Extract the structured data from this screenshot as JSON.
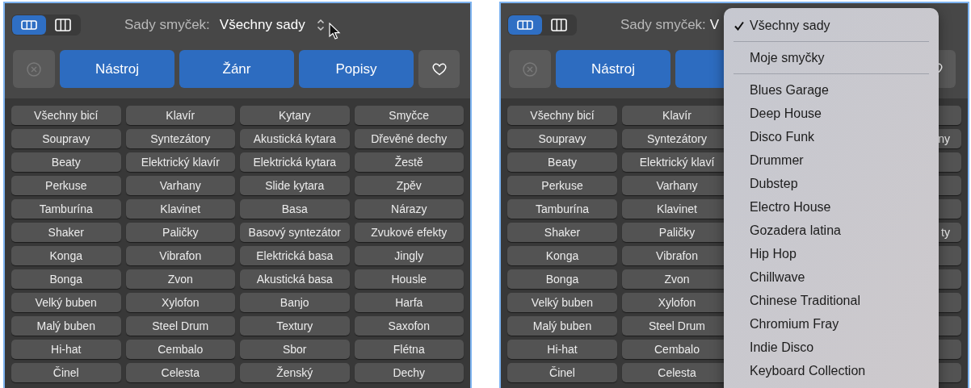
{
  "panels": [
    {
      "view_modes": [
        {
          "selected": true
        },
        {
          "selected": false
        }
      ],
      "loop_sets": {
        "label": "Sady smyček:",
        "value": "Všechny sady"
      },
      "filter_buttons": [
        "Nástroj",
        "Žánr",
        "Popisy"
      ],
      "keywords": [
        {
          "cells": [
            "Všechny bicí",
            "Klavír",
            "Kytary",
            "Smyčce"
          ]
        },
        {
          "cells": [
            "Soupravy",
            "Syntezátory",
            "Akustická kytara",
            "Dřevěné dechy"
          ]
        },
        {
          "cells": [
            "Beaty",
            "Elektrický klavír",
            "Elektrická kytara",
            "Žestě"
          ]
        },
        {
          "cells": [
            "Perkuse",
            "Varhany",
            "Slide kytara",
            "Zpěv"
          ]
        },
        {
          "cells": [
            "Tamburína",
            "Klavinet",
            "Basa",
            "Nárazy"
          ]
        },
        {
          "cells": [
            "Shaker",
            "Paličky",
            "Basový syntezátor",
            "Zvukové efekty"
          ]
        },
        {
          "cells": [
            "Konga",
            "Vibrafon",
            "Elektrická basa",
            "Jingly"
          ]
        },
        {
          "cells": [
            "Bonga",
            "Zvon",
            "Akustická basa",
            "Housle"
          ]
        },
        {
          "cells": [
            "Velký buben",
            "Xylofon",
            "Banjo",
            "Harfa"
          ]
        },
        {
          "cells": [
            "Malý buben",
            "Steel Drum",
            "Textury",
            "Saxofon"
          ]
        },
        {
          "cells": [
            "Hi-hat",
            "Cembalo",
            "Sbor",
            "Flétna"
          ]
        },
        {
          "cells": [
            "Činel",
            "Celesta",
            "Ženský",
            "Dechy"
          ]
        }
      ]
    },
    {
      "view_modes": [
        {
          "selected": true
        },
        {
          "selected": false
        }
      ],
      "loop_sets": {
        "label": "Sady smyček:",
        "value": "V"
      },
      "filter_buttons": [
        "Nástroj"
      ],
      "keywords": [
        {
          "cells": [
            "Všechny bicí",
            "Klavír"
          ]
        },
        {
          "cells": [
            "Soupravy",
            "Syntezátory"
          ],
          "edge": "ny"
        },
        {
          "cells": [
            "Beaty",
            "Elektrický klaví"
          ]
        },
        {
          "cells": [
            "Perkuse",
            "Varhany"
          ]
        },
        {
          "cells": [
            "Tamburína",
            "Klavinet"
          ]
        },
        {
          "cells": [
            "Shaker",
            "Paličky"
          ],
          "edge": "ty"
        },
        {
          "cells": [
            "Konga",
            "Vibrafon"
          ]
        },
        {
          "cells": [
            "Bonga",
            "Zvon"
          ]
        },
        {
          "cells": [
            "Velký buben",
            "Xylofon"
          ]
        },
        {
          "cells": [
            "Malý buben",
            "Steel Drum"
          ]
        },
        {
          "cells": [
            "Hi-hat",
            "Cembalo"
          ]
        },
        {
          "cells": [
            "Činel",
            "Celesta"
          ]
        }
      ],
      "menu": {
        "sections": [
          [
            {
              "label": "Všechny sady",
              "selected": true
            }
          ],
          [
            {
              "label": "Moje smyčky",
              "selected": false
            }
          ],
          [
            {
              "label": "Blues Garage",
              "selected": false
            },
            {
              "label": "Deep House",
              "selected": false
            },
            {
              "label": "Disco Funk",
              "selected": false
            },
            {
              "label": "Drummer",
              "selected": false
            },
            {
              "label": "Dubstep",
              "selected": false
            },
            {
              "label": "Electro House",
              "selected": false
            },
            {
              "label": "Gozadera latina",
              "selected": false
            },
            {
              "label": "Hip Hop",
              "selected": false
            },
            {
              "label": "Chillwave",
              "selected": false
            },
            {
              "label": "Chinese Traditional",
              "selected": false
            },
            {
              "label": "Chromium Fray",
              "selected": false
            },
            {
              "label": "Indie Disco",
              "selected": false
            },
            {
              "label": "Keyboard Collection",
              "selected": false
            }
          ]
        ]
      }
    }
  ]
}
